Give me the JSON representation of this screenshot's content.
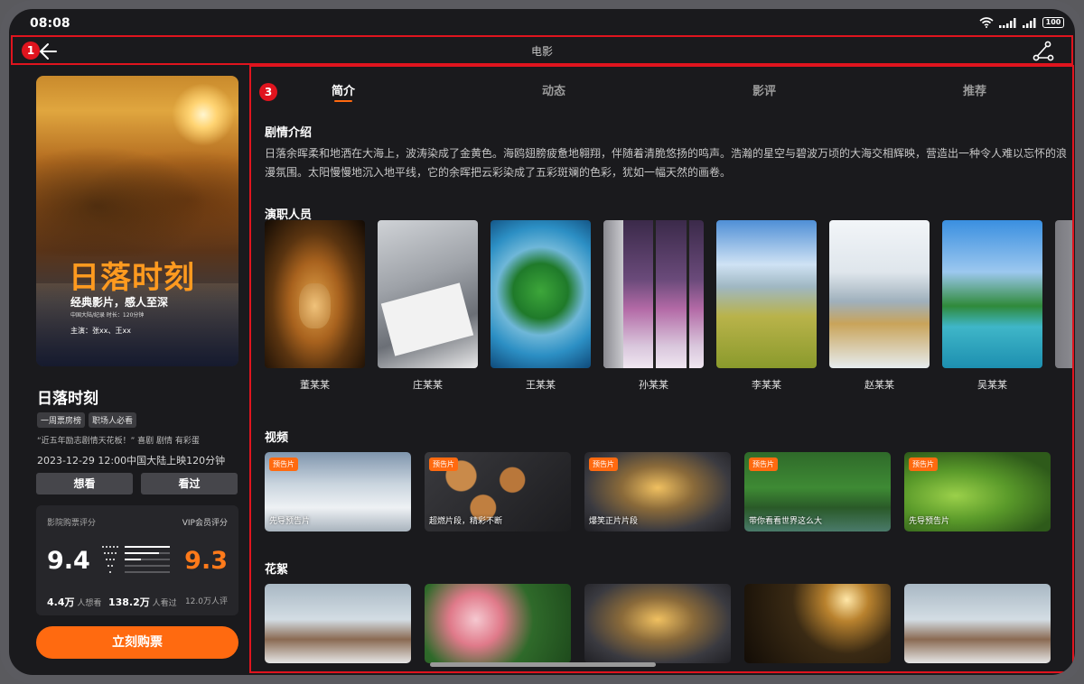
{
  "status_bar": {
    "time": "08:08",
    "battery": "100"
  },
  "header": {
    "title": "电影",
    "badge": "1"
  },
  "left_panel": {
    "poster": {
      "title": "日落时刻",
      "subtitle": "经典影片，感人至深",
      "meta": "中国大陆/纪录 时长：120分钟",
      "cast_line": "主演：张xx、王xx"
    },
    "movie_title": "日落时刻",
    "tags": [
      "一周票房榜",
      "职场人必看"
    ],
    "quote": "“近五年励志剧情天花板！” 喜剧 剧情 有彩蛋",
    "release": "2023-12-29 12:00中国大陆上映120分钟",
    "want_label": "想看",
    "seen_label": "看过",
    "rating": {
      "cinema_label": "影院购票评分",
      "vip_label": "VIP会员评分",
      "score": "9.4",
      "vip_score": "9.3",
      "want_count": "4.4万",
      "want_suffix": "人想看",
      "seen_count": "138.2万",
      "seen_suffix": "人看过",
      "review_count": "12.0万人评"
    },
    "buy_label": "立刻购票"
  },
  "right_panel": {
    "badge": "3",
    "tabs": [
      {
        "label": "简介"
      },
      {
        "label": "动态"
      },
      {
        "label": "影评"
      },
      {
        "label": "推荐"
      }
    ],
    "synopsis_title": "剧情介绍",
    "synopsis": "日落余晖柔和地洒在大海上，波涛染成了金黄色。海鸥翅膀疲惫地翱翔，伴随着清脆悠扬的鸣声。浩瀚的星空与碧波万顷的大海交相辉映，营造出一种令人难以忘怀的浪漫氛围。太阳慢慢地沉入地平线，它的余晖把云彩染成了五彩斑斓的色彩，犹如一幅天然的画卷。",
    "cast_title": "演职人员",
    "cast": [
      {
        "name": "董某某"
      },
      {
        "name": "庄某某"
      },
      {
        "name": "王某某"
      },
      {
        "name": "孙某某"
      },
      {
        "name": "李某某"
      },
      {
        "name": "赵某某"
      },
      {
        "name": "吴某某"
      }
    ],
    "video_title": "视频",
    "videos": [
      {
        "badge": "预告片",
        "caption": "先导预告片"
      },
      {
        "badge": "预告片",
        "caption": "超燃片段，精彩不断"
      },
      {
        "badge": "预告片",
        "caption": "爆笑正片片段"
      },
      {
        "badge": "预告片",
        "caption": "带你看看世界这么大"
      },
      {
        "badge": "预告片",
        "caption": "先导预告片"
      }
    ],
    "clips_title": "花絮"
  },
  "colors": {
    "accent": "#ff6a10",
    "highlight_frame": "#e0141e",
    "background": "#1a1a1d"
  }
}
